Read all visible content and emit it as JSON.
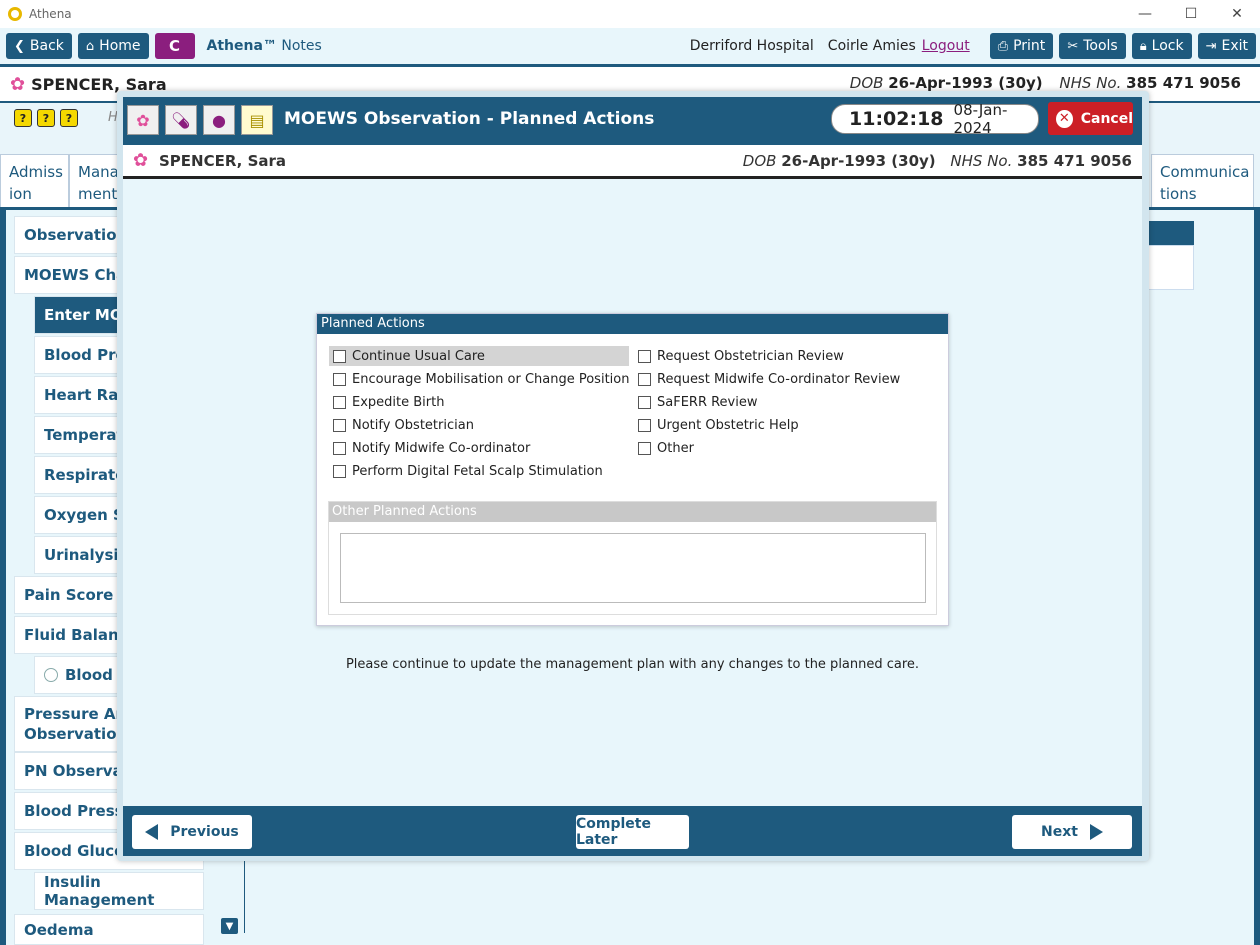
{
  "window": {
    "title": "Athena",
    "minimize": "—",
    "maximize": "☐",
    "close": "✕"
  },
  "toolbar": {
    "back": "Back",
    "home": "Home",
    "c_button": "C",
    "brand_name": "Athena™",
    "brand_suffix": "Notes",
    "hospital": "Derriford Hospital",
    "user": "Coirle Amies",
    "logout": "Logout",
    "print": "Print",
    "tools": "Tools",
    "lock": "Lock",
    "exit": "Exit"
  },
  "patient": {
    "name": "SPENCER, Sara",
    "dob_label": "DOB",
    "dob": "26-Apr-1993 (30y)",
    "nhs_label": "NHS No.",
    "nhs": "385 471 9056"
  },
  "background": {
    "alert_icons": [
      "?",
      "?",
      "?"
    ],
    "h_text": "H",
    "tabs": [
      {
        "label": "Admiss ion"
      },
      {
        "label": "Mana ment"
      },
      {
        "label": "Communica tions"
      }
    ],
    "sidebar": [
      "Observations",
      "MOEWS Chart",
      "Enter MOE",
      "Blood Pres",
      "Heart Rate",
      "Temperatu",
      "Respiratory",
      "Oxygen Sat",
      "Urinalysis",
      "Pain Score",
      "Fluid Balance",
      "Blood Lo",
      "Pressure Areas Observation",
      "PN Observatio",
      "Blood Pressur",
      "Blood Glucose",
      "Insulin Management",
      "Oedema"
    ]
  },
  "modal": {
    "title": "MOEWS Observation - Planned Actions",
    "time": "11:02:18",
    "date": "08-Jan-2024",
    "cancel": "Cancel",
    "panel_title": "Planned Actions",
    "actions_left": [
      {
        "label": "Continue Usual Care",
        "checked": false
      },
      {
        "label": "Encourage Mobilisation or Change Position",
        "checked": false
      },
      {
        "label": "Expedite Birth",
        "checked": false
      },
      {
        "label": "Notify Obstetrician",
        "checked": false
      },
      {
        "label": "Notify Midwife Co-ordinator",
        "checked": false
      },
      {
        "label": "Perform Digital Fetal Scalp Stimulation",
        "checked": false
      }
    ],
    "actions_right": [
      {
        "label": "Request Obstetrician Review",
        "checked": false
      },
      {
        "label": "Request Midwife Co-ordinator Review",
        "checked": false
      },
      {
        "label": "SaFERR Review",
        "checked": false
      },
      {
        "label": "Urgent Obstetric Help",
        "checked": false
      },
      {
        "label": "Other",
        "checked": false
      }
    ],
    "other_title": "Other Planned Actions",
    "other_value": "",
    "info": "Please continue to update the management plan with any changes to the planned care.",
    "previous": "Previous",
    "complete_later": "Complete Later",
    "next": "Next"
  },
  "colors": {
    "primary": "#1e5a7e",
    "accent_purple": "#8b1e7e",
    "cancel_red": "#cc1f26",
    "background": "#e8f6fb"
  }
}
